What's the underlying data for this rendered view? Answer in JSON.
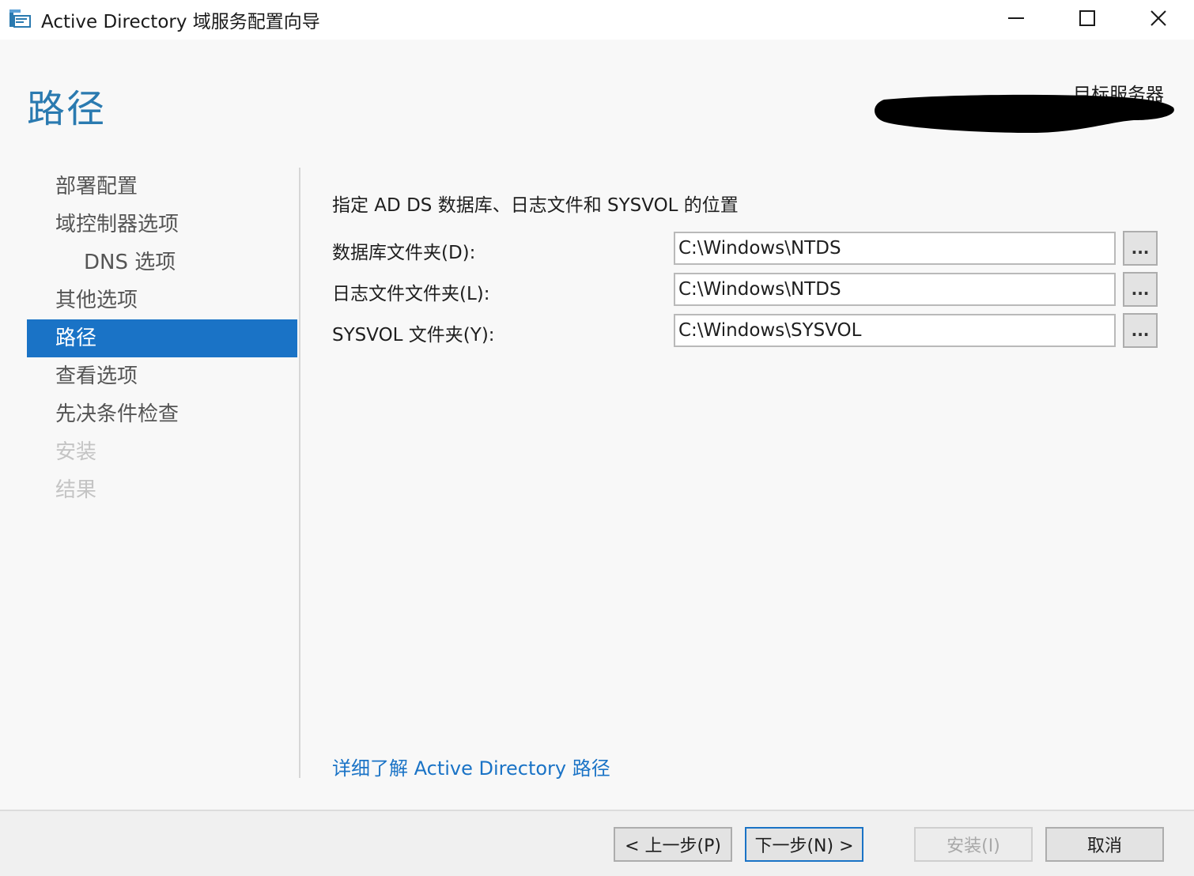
{
  "window": {
    "title": "Active Directory 域服务配置向导"
  },
  "header": {
    "page_title": "路径",
    "target_server_label": "目标服务器"
  },
  "nav": {
    "items": [
      {
        "label": "部署配置",
        "state": "normal"
      },
      {
        "label": "域控制器选项",
        "state": "normal"
      },
      {
        "label": "DNS 选项",
        "state": "sub"
      },
      {
        "label": "其他选项",
        "state": "normal"
      },
      {
        "label": "路径",
        "state": "active"
      },
      {
        "label": "查看选项",
        "state": "normal"
      },
      {
        "label": "先决条件检查",
        "state": "normal"
      },
      {
        "label": "安装",
        "state": "disabled"
      },
      {
        "label": "结果",
        "state": "disabled"
      }
    ]
  },
  "main": {
    "description": "指定 AD DS 数据库、日志文件和 SYSVOL 的位置",
    "fields": [
      {
        "label": "数据库文件夹(D):",
        "value": "C:\\Windows\\NTDS",
        "browse_label": "..."
      },
      {
        "label": "日志文件文件夹(L):",
        "value": "C:\\Windows\\NTDS",
        "browse_label": "..."
      },
      {
        "label": "SYSVOL 文件夹(Y):",
        "value": "C:\\Windows\\SYSVOL",
        "browse_label": "..."
      }
    ],
    "learn_more_link": "详细了解 Active Directory 路径"
  },
  "footer": {
    "prev_label": "< 上一步(P)",
    "next_label": "下一步(N) >",
    "install_label": "安装(I)",
    "cancel_label": "取消"
  },
  "colors": {
    "accent": "#1a73c6",
    "heading": "#2a7ab0",
    "disabled_text": "#c4c4c4"
  }
}
